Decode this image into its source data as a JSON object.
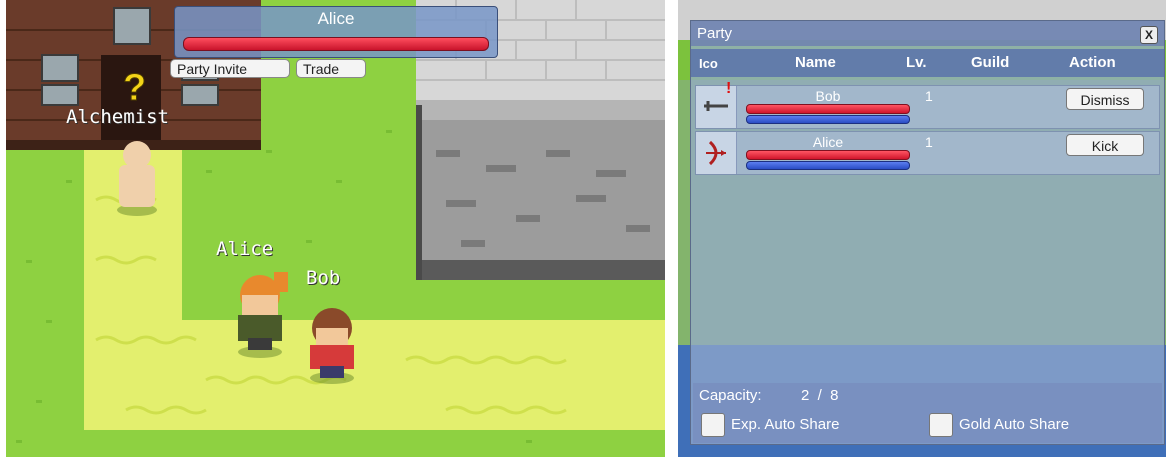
{
  "game": {
    "target": {
      "name": "Alice",
      "hp_fraction": 1.0
    },
    "actions": {
      "party_invite": "Party Invite",
      "trade": "Trade"
    },
    "npc": {
      "name": "Alchemist",
      "quest_marker": "?"
    },
    "players": [
      {
        "name": "Alice"
      },
      {
        "name": "Bob"
      }
    ]
  },
  "party": {
    "title": "Party",
    "close_label": "X",
    "columns": [
      "Ico",
      "Name",
      "Lv.",
      "Guild",
      "Action"
    ],
    "members": [
      {
        "name": "Bob",
        "level": "1",
        "guild": "",
        "action": "Dismiss",
        "hp_fraction": 1.0,
        "mp_fraction": 1.0,
        "icon": "sword-icon",
        "leader_mark": "!"
      },
      {
        "name": "Alice",
        "level": "1",
        "guild": "",
        "action": "Kick",
        "hp_fraction": 1.0,
        "mp_fraction": 1.0,
        "icon": "bow-icon"
      }
    ],
    "capacity_label": "Capacity:",
    "capacity_value": "2  /  8",
    "exp_share_label": "Exp. Auto Share",
    "gold_share_label": "Gold Auto Share"
  },
  "colors": {
    "hp": "#e0233a",
    "mp": "#3a5fd8",
    "grass": "#8ed141",
    "path": "#e3ef6e"
  }
}
